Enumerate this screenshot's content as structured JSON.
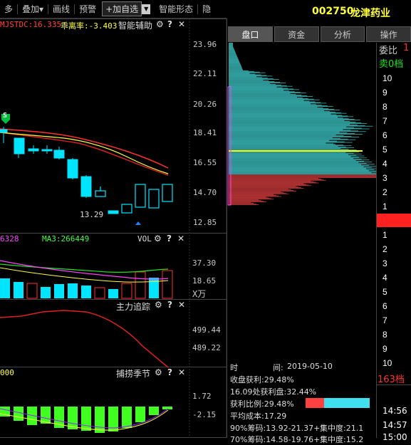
{
  "toolbar": {
    "items": [
      "多",
      "叠加▾",
      "画线",
      "预警"
    ],
    "add_button": "+加自选",
    "dropdown": "▼",
    "smart_form": "智能形态",
    "hidden": "隐"
  },
  "stock": {
    "code": "002750",
    "name": "龙津药业"
  },
  "tabs": [
    "盘口",
    "资金",
    "分析",
    "操作"
  ],
  "main_panel": {
    "indicator_a": "MJSTDC:16.335",
    "indicator_b": "乖离率:-3.403",
    "assist": "智能辅助",
    "price_axis": [
      "23.96",
      "22.11",
      "20.26",
      "18.41",
      "16.55",
      "14.70",
      "12.85"
    ],
    "low_label": "13.29",
    "signal_label": "S"
  },
  "vol_panel": {
    "ma_a": "6328",
    "ma3": "MA3:266449",
    "name": "VOL",
    "axis": [
      "37.30",
      "18.65"
    ],
    "unit": "X万"
  },
  "main_force_panel": {
    "name": "主力追踪",
    "axis": [
      "499.44",
      "489.22"
    ]
  },
  "season_panel": {
    "left_value": "000",
    "name": "捕捞季节",
    "axis": [
      "1.72",
      "-2.15"
    ]
  },
  "controls": {
    "gear": "⚙",
    "help": "?",
    "close": "✕"
  },
  "orderbook": {
    "weibi": "委比",
    "weibi_val": "1",
    "sell_label": "卖0档",
    "sell_levels": [
      "10",
      "9",
      "8",
      "7",
      "6",
      "5",
      "4",
      "3",
      "2",
      "1"
    ],
    "buy_levels": [
      "1",
      "2",
      "3",
      "4",
      "5",
      "6",
      "7",
      "8",
      "9",
      "10"
    ],
    "buy_count": "163档"
  },
  "chip_info": {
    "time_label": "时",
    "time_mid": "间:",
    "time_value": "2019-05-10",
    "profit": "收盘获利:29.48%",
    "profit_at": "16.09处获利盘:32.44%",
    "ratio": "获利比例:29.48%",
    "avg_cost": "平均成本:17.29",
    "chip90": "90%筹码:13.92-21.37+",
    "conc90": "集中度:21.1",
    "chip70": "70%筹码:14.58-19.76+",
    "conc70": "集中度:15.2"
  },
  "times": [
    "14:56",
    "14:57",
    "15:00"
  ],
  "colors": {
    "up": "#ff3232",
    "down": "#00e5ff",
    "yellow": "#ffff00",
    "chip_blue": "#40d0d0",
    "chip_red": "#e04040"
  }
}
